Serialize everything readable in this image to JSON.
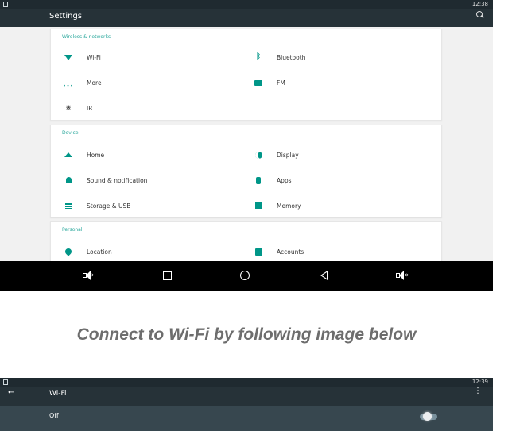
{
  "settings_screen": {
    "status_time": "12:38",
    "title": "Settings",
    "sections": [
      {
        "header": "Wireless & networks",
        "items": [
          {
            "label": "Wi-Fi",
            "icon": "wifi-icon"
          },
          {
            "label": "Bluetooth",
            "icon": "bluetooth-icon"
          },
          {
            "label": "More",
            "icon": "more-dots-icon"
          },
          {
            "label": "FM",
            "icon": "fm-radio-icon"
          },
          {
            "label": "IR",
            "icon": "ir-icon"
          }
        ]
      },
      {
        "header": "Device",
        "items": [
          {
            "label": "Home",
            "icon": "home-icon"
          },
          {
            "label": "Display",
            "icon": "display-icon"
          },
          {
            "label": "Sound & notification",
            "icon": "bell-icon"
          },
          {
            "label": "Apps",
            "icon": "apps-icon"
          },
          {
            "label": "Storage & USB",
            "icon": "storage-icon"
          },
          {
            "label": "Memory",
            "icon": "memory-icon"
          }
        ]
      },
      {
        "header": "Personal",
        "items": [
          {
            "label": "Location",
            "icon": "location-icon"
          },
          {
            "label": "Accounts",
            "icon": "accounts-icon"
          }
        ]
      }
    ],
    "nav_icons": [
      "volume-down-icon",
      "recent-apps-icon",
      "home-circle-icon",
      "back-icon",
      "volume-up-icon"
    ]
  },
  "caption": "Connect to Wi-Fi by following image below",
  "wifi_screen": {
    "status_time": "12:39",
    "title": "Wi-Fi",
    "toggle_label": "Off",
    "toggle_state": "off"
  },
  "colors": {
    "accent": "#009688",
    "toolbar": "#263238",
    "navbar": "#000000"
  }
}
